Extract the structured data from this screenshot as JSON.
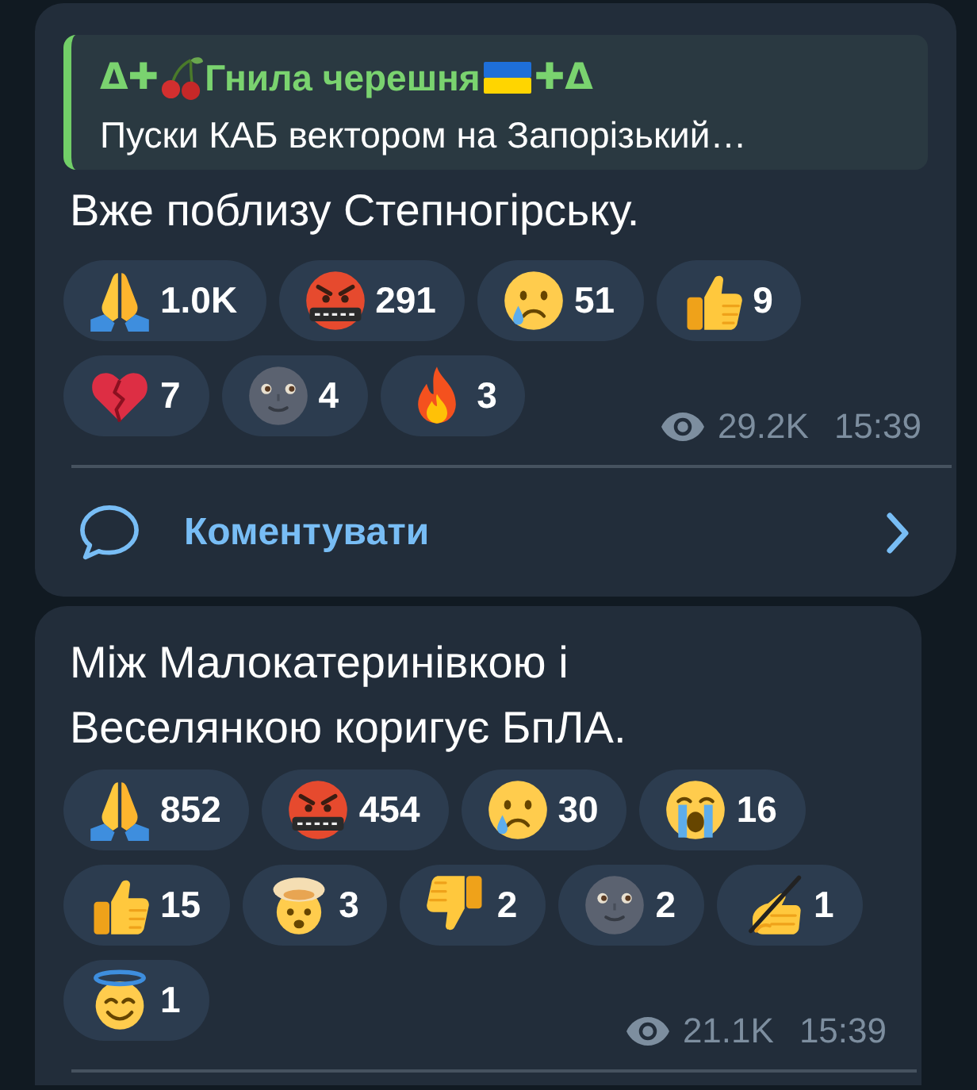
{
  "messages": [
    {
      "reply": {
        "sender_prefix": "Δ✚",
        "sender_name": "Гнила черешня",
        "sender_suffix": "✚Δ",
        "text": "Пуски КАБ вектором на Запорізький…"
      },
      "text": "Вже поблизу Степногірську.",
      "reactions": [
        {
          "kind": "pray",
          "count": "1.0K"
        },
        {
          "kind": "cursing",
          "count": "291"
        },
        {
          "kind": "crying",
          "count": "51"
        },
        {
          "kind": "thumbsup",
          "count": "9"
        },
        {
          "kind": "brokenheart",
          "count": "7"
        },
        {
          "kind": "moon",
          "count": "4"
        },
        {
          "kind": "fire",
          "count": "3"
        }
      ],
      "views": "29.2K",
      "time": "15:39",
      "comments": {
        "label": "Коментувати"
      }
    },
    {
      "text": "Між Малокатеринівкою і Веселянкою коригує БпЛА.",
      "reactions": [
        {
          "kind": "pray",
          "count": "852"
        },
        {
          "kind": "cursing",
          "count": "454"
        },
        {
          "kind": "crying",
          "count": "30"
        },
        {
          "kind": "sobbing",
          "count": "16"
        },
        {
          "kind": "thumbsup",
          "count": "15"
        },
        {
          "kind": "exploding",
          "count": "3"
        },
        {
          "kind": "thumbsdown",
          "count": "2"
        },
        {
          "kind": "moon",
          "count": "2"
        },
        {
          "kind": "writing",
          "count": "1"
        },
        {
          "kind": "halo",
          "count": "1"
        }
      ],
      "views": "21.1K",
      "time": "15:39"
    }
  ]
}
